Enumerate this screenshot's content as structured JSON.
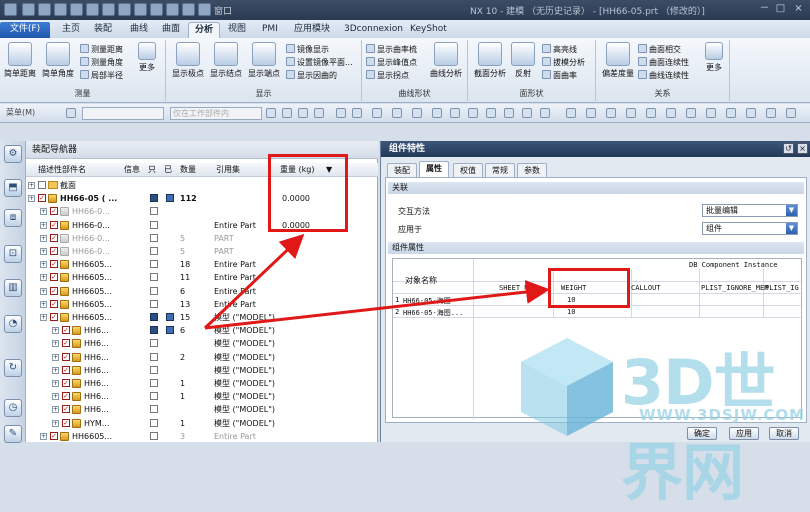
{
  "titlebar": {
    "title": "NX 10 - 建模 （无历史记录） - [HH66-05.prt （修改的）]",
    "window_menu": "窗口",
    "controls": [
      "－",
      "□",
      "×"
    ]
  },
  "ribbon_tabs": [
    "文件(F)",
    "主页",
    "装配",
    "曲线",
    "曲面",
    "分析",
    "视图",
    "PMI",
    "应用模块",
    "3Dconnexion",
    "KeyShot"
  ],
  "ribbon_active_tab": "分析",
  "ribbon": {
    "groups": [
      {
        "label": "测量",
        "big": [
          "简单距离",
          "简单角度"
        ],
        "small": [
          "测量距离",
          "测量角度",
          "局部半径"
        ],
        "more": "更多"
      },
      {
        "label": "显示",
        "big": [
          "显示极点",
          "显示结点",
          "显示端点"
        ],
        "small": [
          "镜像显示",
          "设置镜像平面...",
          "显示因曲的"
        ]
      },
      {
        "label": "曲线形状",
        "small": [
          "显示曲率梳",
          "显示峰值点",
          "显示拐点"
        ],
        "big": [
          "曲线分析"
        ]
      },
      {
        "label": "面形状",
        "big": [
          "截面分析",
          "反射"
        ],
        "small": [
          "高亮线",
          "拔模分析",
          "面曲率"
        ]
      },
      {
        "label": "关系",
        "big": [
          "偏差度量"
        ],
        "small": [
          "曲面相交",
          "曲面连续性",
          "曲线连续性"
        ],
        "more": "更多"
      }
    ]
  },
  "toolbar": {
    "menu": "菜单(M)",
    "dropdown1": "",
    "dropdown2": "仅在工作部件内"
  },
  "nav": {
    "title": "装配导航器",
    "columns": {
      "name": "描述性部件名",
      "info": "信息",
      "readonly": "只",
      "modified": "已",
      "qty": "数量",
      "refset": "引用集",
      "weight": "重量 (kg)"
    },
    "rows": [
      {
        "name": "截面",
        "qty": "",
        "refset": "",
        "weight": ""
      },
      {
        "name": "HH66-05 ( ...",
        "qty": "112",
        "refset": "",
        "weight": "0.0000"
      },
      {
        "name": "HH66-0...",
        "qty": "",
        "refset": "",
        "weight": ""
      },
      {
        "name": "HH66-0...",
        "qty": "",
        "refset": "Entire Part",
        "weight": "0.0000"
      },
      {
        "name": "HH66-0...",
        "qty": "5",
        "refset": "PART",
        "weight": ""
      },
      {
        "name": "HH66-0...",
        "qty": "5",
        "refset": "PART",
        "weight": ""
      },
      {
        "name": "HH6605...",
        "qty": "18",
        "refset": "Entire Part",
        "weight": ""
      },
      {
        "name": "HH6605...",
        "qty": "11",
        "refset": "Entire Part",
        "weight": ""
      },
      {
        "name": "HH6605...",
        "qty": "6",
        "refset": "Entire Part",
        "weight": ""
      },
      {
        "name": "HH6605...",
        "qty": "13",
        "refset": "Entire Part",
        "weight": ""
      },
      {
        "name": "HH6605...",
        "qty": "15",
        "refset": "模型 (\"MODEL\")",
        "weight": ""
      },
      {
        "name": "HH6...",
        "qty": "6",
        "refset": "模型 (\"MODEL\")",
        "weight": ""
      },
      {
        "name": "HH6...",
        "qty": "",
        "refset": "模型 (\"MODEL\")",
        "weight": ""
      },
      {
        "name": "HH6...",
        "qty": "2",
        "refset": "模型 (\"MODEL\")",
        "weight": ""
      },
      {
        "name": "HH6...",
        "qty": "",
        "refset": "模型 (\"MODEL\")",
        "weight": ""
      },
      {
        "name": "HH6...",
        "qty": "1",
        "refset": "模型 (\"MODEL\")",
        "weight": ""
      },
      {
        "name": "HH6...",
        "qty": "1",
        "refset": "模型 (\"MODEL\")",
        "weight": ""
      },
      {
        "name": "HH6...",
        "qty": "",
        "refset": "模型 (\"MODEL\")",
        "weight": ""
      },
      {
        "name": "HYM...",
        "qty": "1",
        "refset": "模型 (\"MODEL\")",
        "weight": ""
      },
      {
        "name": "HH6605...",
        "qty": "3",
        "refset": "Entire Part",
        "weight": ""
      }
    ]
  },
  "dialog": {
    "title": "组件特性",
    "tabs": [
      "装配",
      "属性",
      "权值",
      "常规",
      "参数"
    ],
    "active_tab": "属性",
    "section_relation": "关联",
    "interaction_label": "交互方法",
    "interaction_value": "批量编辑",
    "apply_to_label": "应用于",
    "apply_to_value": "组件",
    "section_attributes": "组件属性",
    "table": {
      "group_header": "DB Component Instance",
      "obj_col": "对象名称",
      "columns": [
        "SHEET_NA...",
        "WEIGHT",
        "CALLOUT",
        "PLIST_IGNORE_MEM",
        "PLIST_IG"
      ],
      "rows": [
        {
          "index": "1",
          "name": "HH66-05-海图",
          "weight": "10"
        },
        {
          "index": "2",
          "name": "HH66-05-海图...",
          "weight": "10"
        }
      ]
    },
    "buttons": {
      "ok": "确定",
      "apply": "应用",
      "cancel": "取消"
    }
  },
  "watermark": {
    "text": "3D世界网",
    "url": "WWW.3DSJW.COM"
  },
  "colors": {
    "highlight": "#e01818",
    "title_bar": "#2a3a52",
    "accent": "#1f58ad"
  }
}
